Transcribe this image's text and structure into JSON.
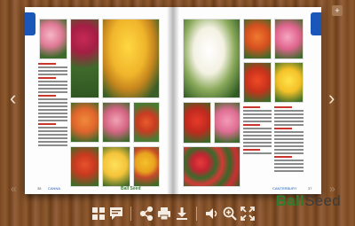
{
  "book": {
    "left_page": {
      "folio": "38",
      "section": "CANNA",
      "logo": "Ball Seed"
    },
    "right_page": {
      "folio": "37",
      "section": "CANTERBURY"
    }
  },
  "brand": {
    "part1": "Ball",
    "part2": "Seed"
  },
  "nav": {
    "prev": "‹",
    "next": "›",
    "first": "«",
    "last": "»",
    "corner": "+"
  },
  "colors": {
    "accent_blue": "#1a57b8",
    "brand_green": "#2e7d2f"
  }
}
